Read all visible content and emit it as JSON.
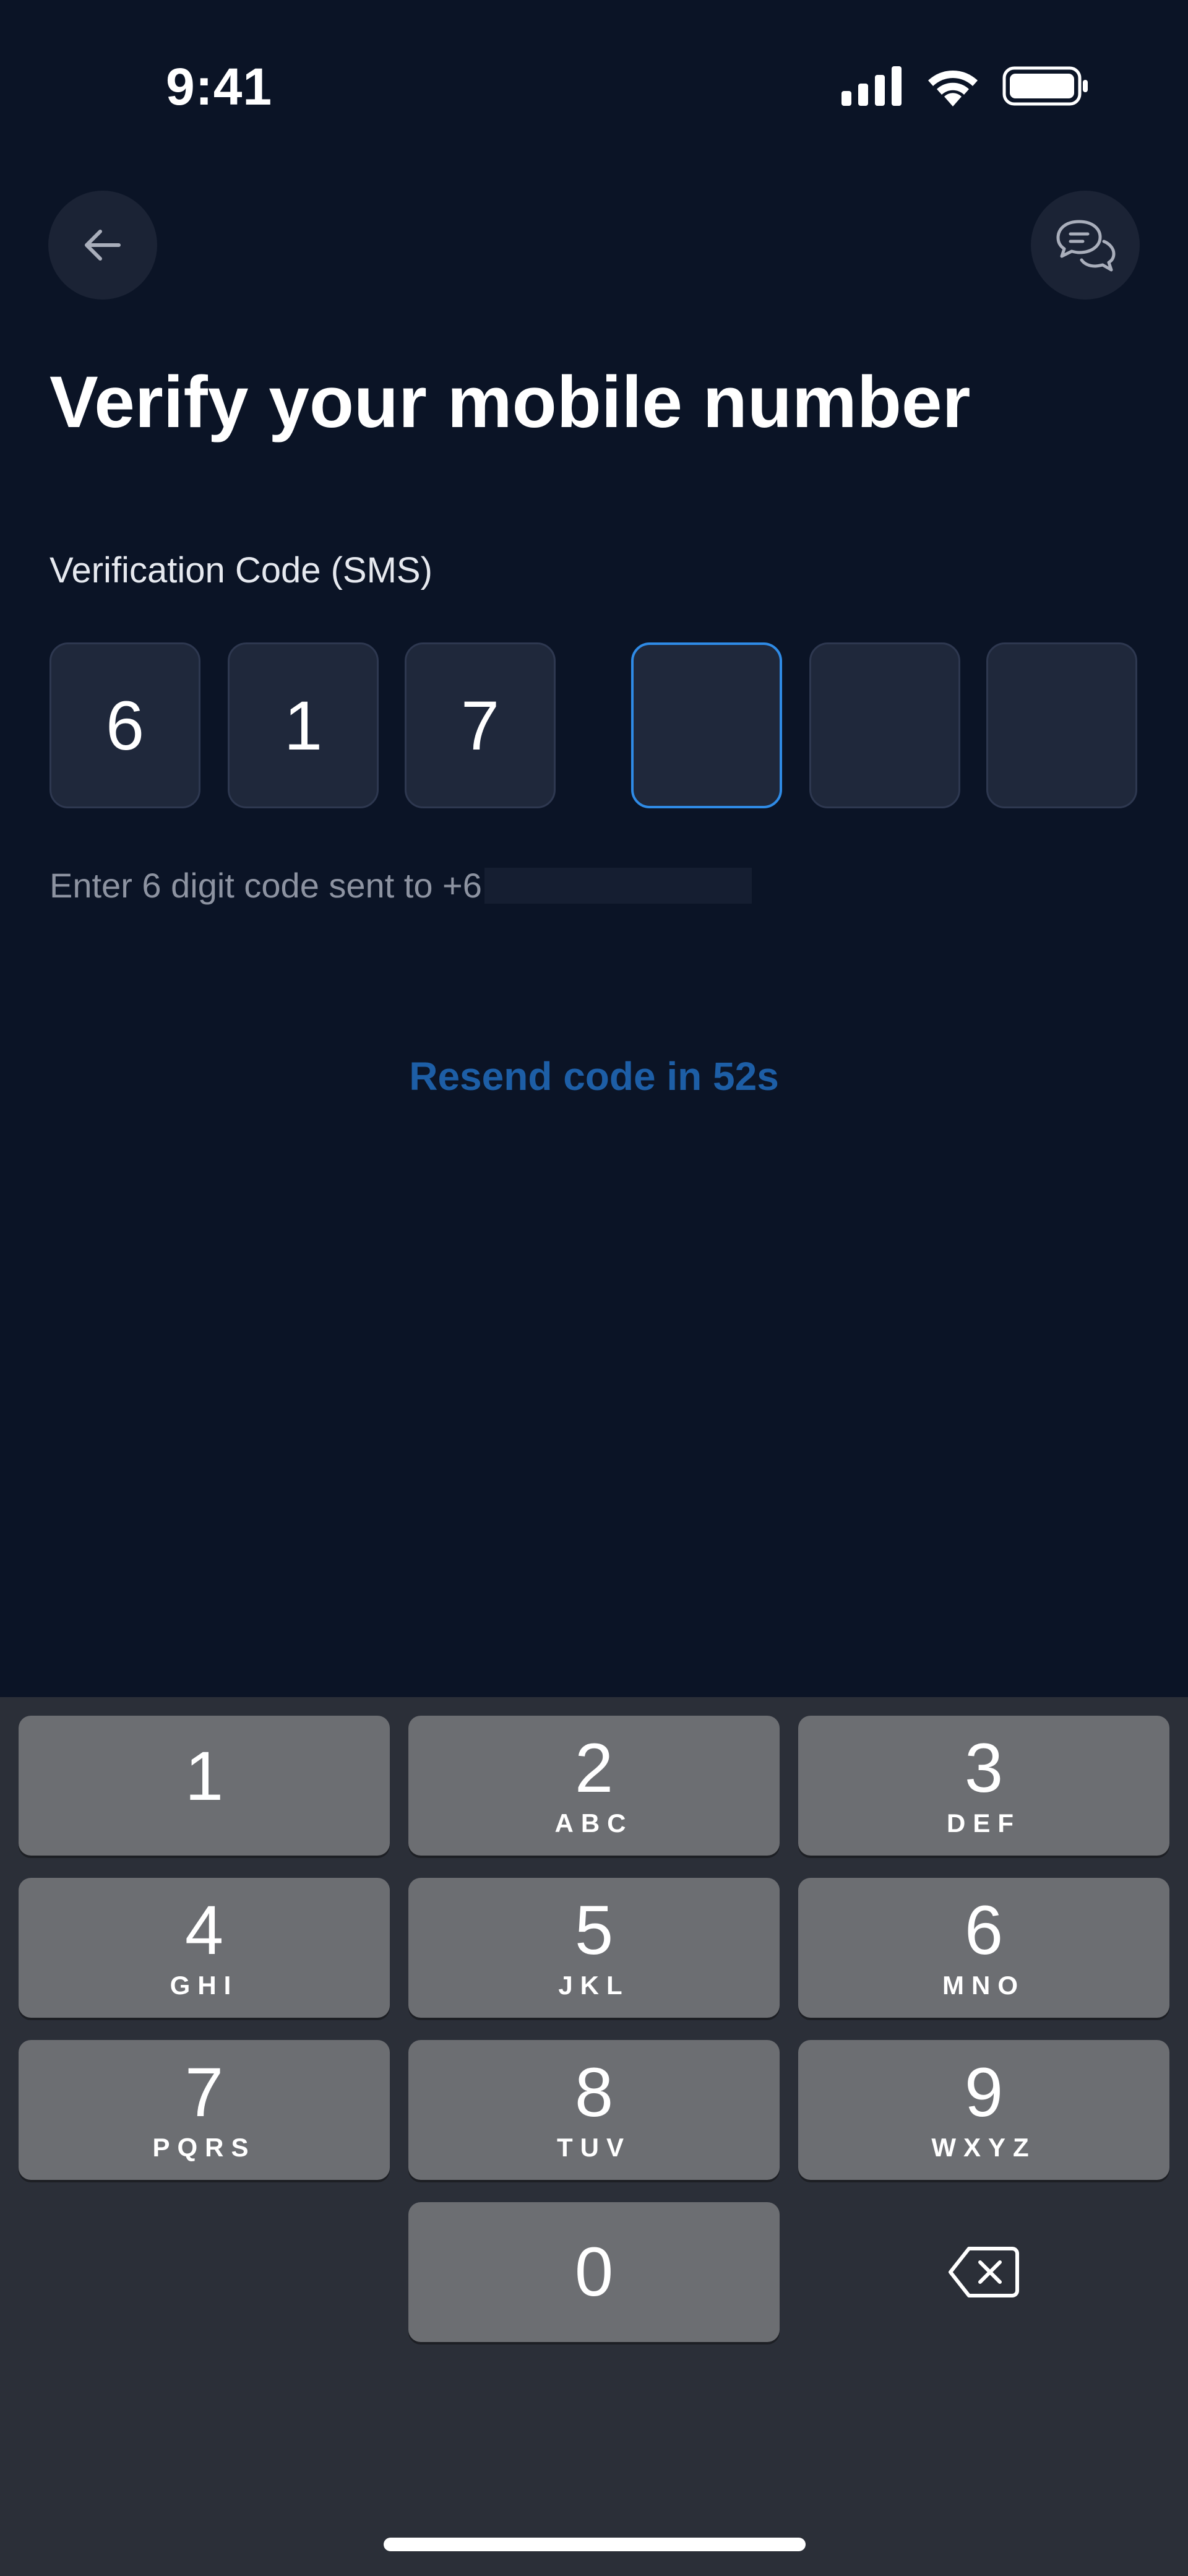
{
  "status_bar": {
    "time": "9:41"
  },
  "header": {
    "back_icon": "arrow-left-icon",
    "chat_icon": "chat-bubbles-icon"
  },
  "title": "Verify your mobile number",
  "otp": {
    "label": "Verification Code (SMS)",
    "digits": [
      "6",
      "1",
      "7",
      "",
      "",
      ""
    ],
    "hint_prefix": "Enter 6 digit code sent to +6"
  },
  "resend": "Resend code in 52s",
  "colors": {
    "background": "#0b1426",
    "accent": "#2f8be6",
    "resend": "#1d5ea6",
    "keyboard": "#2b2f38",
    "key": "#6c6e72"
  },
  "keypad": {
    "keys": [
      {
        "digit": "1",
        "letters": ""
      },
      {
        "digit": "2",
        "letters": "ABC"
      },
      {
        "digit": "3",
        "letters": "DEF"
      },
      {
        "digit": "4",
        "letters": "GHI"
      },
      {
        "digit": "5",
        "letters": "JKL"
      },
      {
        "digit": "6",
        "letters": "MNO"
      },
      {
        "digit": "7",
        "letters": "PQRS"
      },
      {
        "digit": "8",
        "letters": "TUV"
      },
      {
        "digit": "9",
        "letters": "WXYZ"
      },
      {
        "digit": "0",
        "letters": ""
      }
    ],
    "delete_icon": "backspace-icon"
  }
}
